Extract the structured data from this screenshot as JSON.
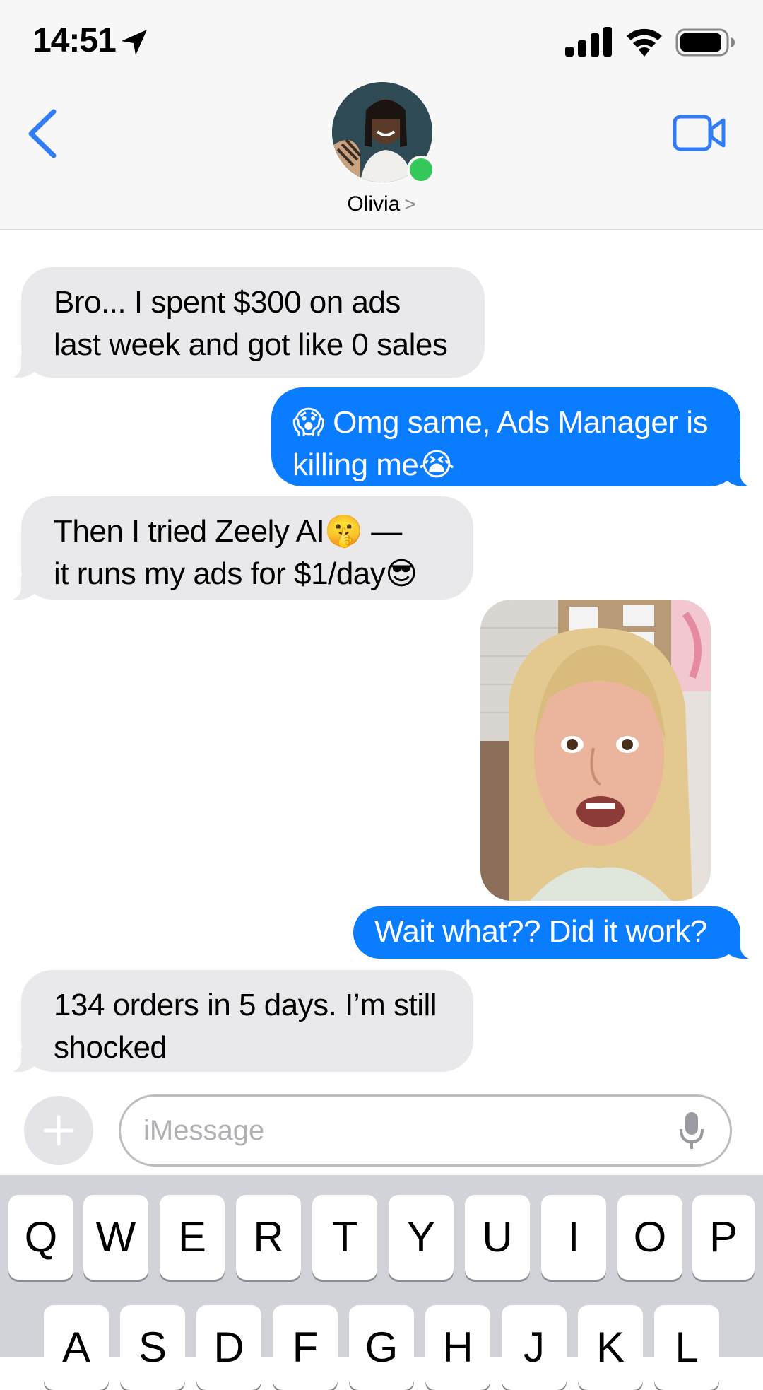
{
  "status_bar": {
    "time": "14:51",
    "icons": [
      "location-arrow-icon",
      "cellular-signal-icon",
      "wifi-icon",
      "battery-icon"
    ]
  },
  "header": {
    "contact_name": "Olivia",
    "chevron": ">",
    "back_icon": "chevron-left-icon",
    "video_icon": "facetime-video-icon",
    "online_status": "online"
  },
  "messages": [
    {
      "from": "them",
      "text": "Bro... I spent $300 on ads last week and got like 0 sales"
    },
    {
      "from": "me",
      "text_prefix_emoji": "😱",
      "text": " Omg same, Ads Manager is killing me",
      "text_suffix_emoji": "😭"
    },
    {
      "from": "them",
      "line1": "Then I tried Zeely AI",
      "emoji1": "🤫",
      "line1_tail": "  —",
      "line2": "it runs my ads for $1/day",
      "emoji2": "😎"
    },
    {
      "from": "me",
      "type": "photo"
    },
    {
      "from": "me",
      "text": "Wait what?? Did it work?"
    },
    {
      "from": "them",
      "text": "134 orders in 5 days. I’m still shocked"
    }
  ],
  "composer": {
    "placeholder": "iMessage",
    "plus_icon": "plus-icon",
    "mic_icon": "microphone-icon"
  },
  "keyboard": {
    "row1": [
      "Q",
      "W",
      "E",
      "R",
      "T",
      "Y",
      "U",
      "I",
      "O",
      "P"
    ],
    "row2": [
      "A",
      "S",
      "D",
      "F",
      "G",
      "H",
      "J",
      "K",
      "L"
    ]
  },
  "colors": {
    "accent": "#0a7cff",
    "incoming_bubble": "#e9e9eb",
    "online": "#34c759",
    "ios_blue": "#2f7cf6"
  }
}
